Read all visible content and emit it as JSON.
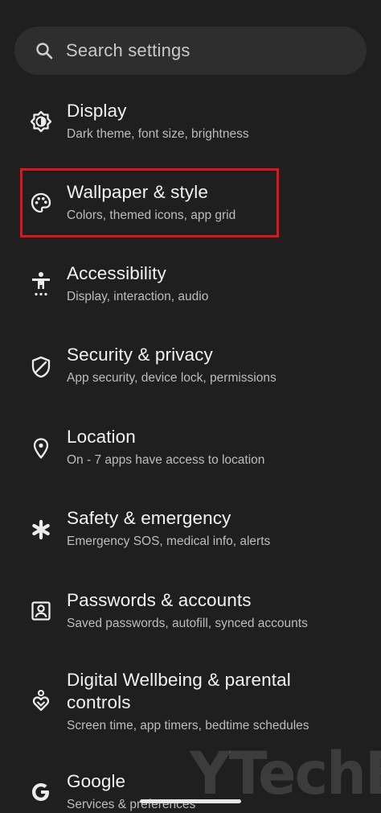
{
  "search": {
    "placeholder": "Search settings",
    "icon": "search-icon"
  },
  "items": [
    {
      "title": "Display",
      "subtitle": "Dark theme, font size, brightness",
      "icon": "brightness-icon"
    },
    {
      "title": "Wallpaper & style",
      "subtitle": "Colors, themed icons, app grid",
      "icon": "palette-icon"
    },
    {
      "title": "Accessibility",
      "subtitle": "Display, interaction, audio",
      "icon": "accessibility-icon"
    },
    {
      "title": "Security & privacy",
      "subtitle": "App security, device lock, permissions",
      "icon": "shield-icon"
    },
    {
      "title": "Location",
      "subtitle": "On - 7 apps have access to location",
      "icon": "location-pin-icon"
    },
    {
      "title": "Safety & emergency",
      "subtitle": "Emergency SOS, medical info, alerts",
      "icon": "asterisk-icon"
    },
    {
      "title": "Passwords & accounts",
      "subtitle": "Saved passwords, autofill, synced accounts",
      "icon": "account-box-icon"
    },
    {
      "title_line1": "Digital Wellbeing & parental",
      "title_line2": "controls",
      "subtitle": "Screen time, app timers, bedtime schedules",
      "icon": "wellbeing-icon"
    },
    {
      "title": "Google",
      "subtitle": "Services & preferences",
      "icon": "google-g-icon"
    }
  ],
  "watermark": "YTechB",
  "colors": {
    "background": "#1f1f1f",
    "search_background": "#2e2e2e",
    "highlight": "#e0141e"
  }
}
